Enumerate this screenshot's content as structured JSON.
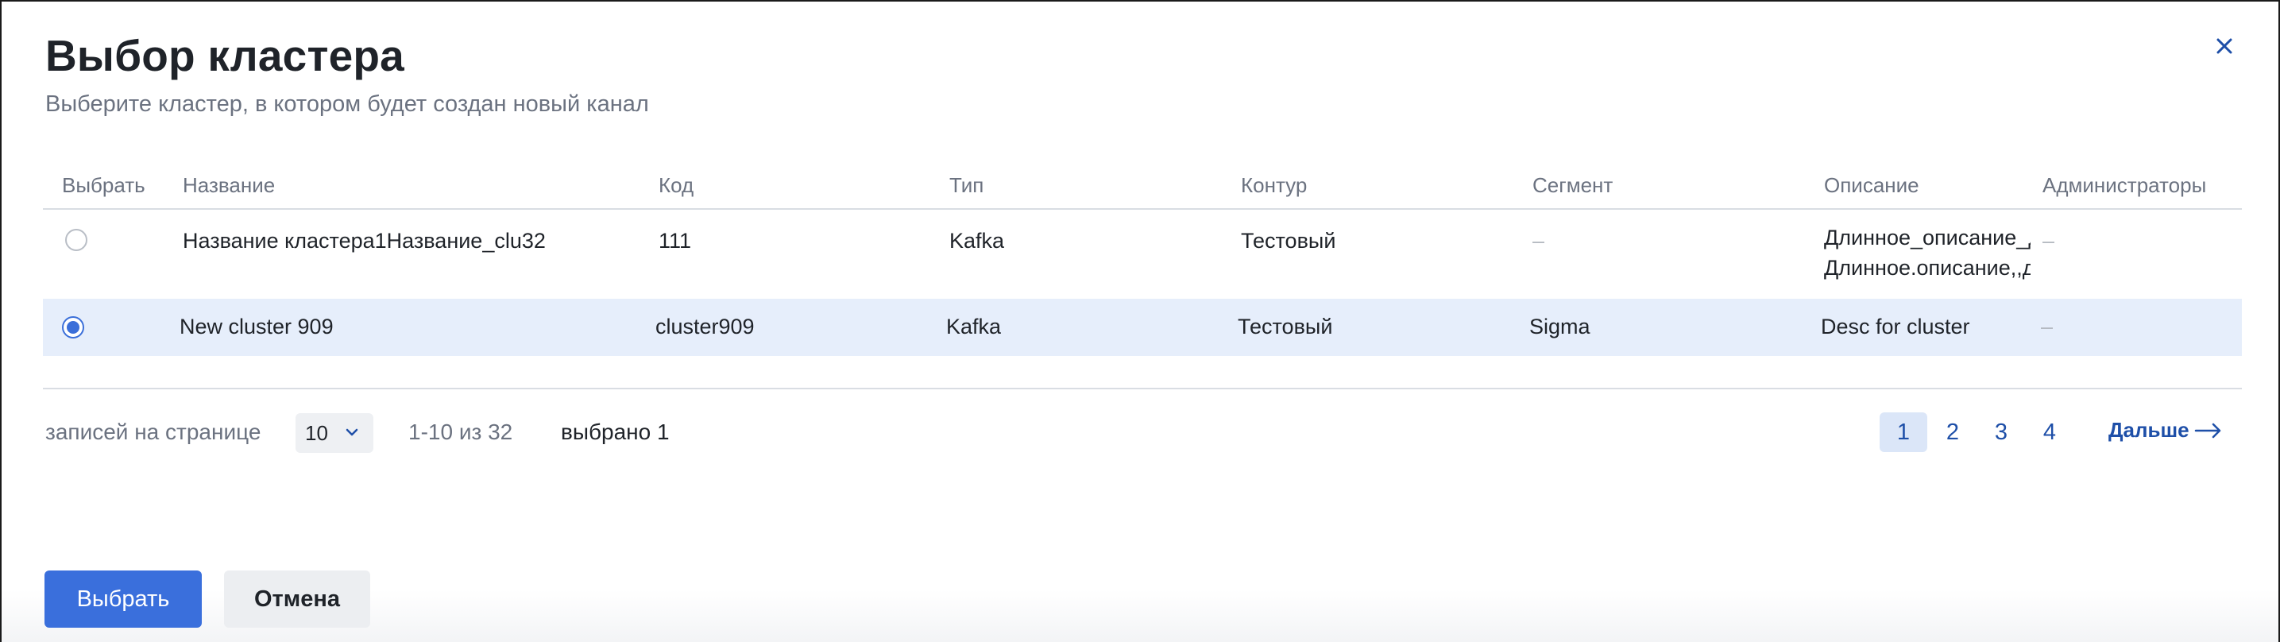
{
  "dialog": {
    "title": "Выбор кластера",
    "subtitle": "Выберите кластер, в котором будет создан новый канал",
    "close_icon": "close-icon"
  },
  "table": {
    "columns": [
      "Выбрать",
      "Название",
      "Код",
      "Тип",
      "Контур",
      "Сегмент",
      "Описание",
      "Администраторы"
    ],
    "rows": [
      {
        "selected": false,
        "name": "Название кластера1Название_clu32",
        "code": "111",
        "type": "Kafka",
        "contour": "Тестовый",
        "segment": "–",
        "description_line1": "Длинное_описание_длинное",
        "description_line2": "Длинное.описание,,длинное",
        "admins": "–"
      },
      {
        "selected": true,
        "name": "New cluster 909",
        "code": "cluster909",
        "type": "Kafka",
        "contour": "Тестовый",
        "segment": "Sigma",
        "description": "Desc for cluster",
        "admins": "–"
      }
    ]
  },
  "pagination": {
    "per_page_label": "записей на странице",
    "per_page_value": "10",
    "range": "1-10 из 32",
    "selected_count": "выбрано 1",
    "pages": [
      "1",
      "2",
      "3",
      "4"
    ],
    "current_page": "1",
    "next_label": "Дальше"
  },
  "footer": {
    "primary_label": "Выбрать",
    "secondary_label": "Отмена"
  },
  "colors": {
    "accent": "#3a6fdc",
    "link": "#1e4fa8",
    "selected_row": "#e6eefb"
  }
}
